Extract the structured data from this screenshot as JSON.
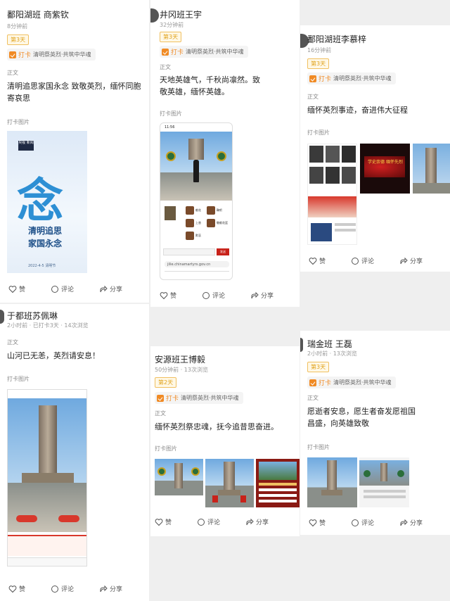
{
  "tabs": {
    "like": "赞",
    "comment": "评论",
    "share": "分享"
  },
  "checkin": {
    "label": "打卡",
    "topic": "清明祭英烈·共筑中华魂",
    "text_section": "正文",
    "image_section": "打卡图片"
  },
  "posts": [
    {
      "author": "鄱阳湖班 商紫钦",
      "meta": "8分钟前",
      "day": "第3天",
      "content": "清明追思家国永念 致敬英烈，缅怀同胞寄哀思",
      "poster": {
        "logo": "央视 新闻",
        "big_char": "念",
        "line1": "清明追思",
        "line2": "家国永念",
        "date": "2022-4-5 清明节"
      }
    },
    {
      "author": "井冈班王宇",
      "meta": "32分钟前",
      "day": "第3天",
      "content": "天地英雄气，千秋尚凛然。致敬英雄，缅怀英雄。",
      "phone": {
        "time": "11:56",
        "items": [
          "献花",
          "鞠躬",
          "上香",
          "敬献花篮",
          "默哀"
        ],
        "url": "jilie.chinamartyrs.gov.cn",
        "send": "发送"
      }
    },
    {
      "author": "鄱阳湖班李慕梓",
      "meta": "16分钟前",
      "day": "第3天",
      "content": "缅怀英烈事迹，奋进伟大征程",
      "banner": "学史崇德 缅怀先烈"
    },
    {
      "author": "于都班苏佩琳",
      "meta": "2小时前 · 已打卡3天 · 14次浏览",
      "content": "山河已无恙，英烈请安息！"
    },
    {
      "author": "安源班王博毅",
      "meta": "50分钟前 · 13次浏览",
      "day": "第2天",
      "content": "缅怀英烈祭忠魂，抚今追昔思奋进。"
    },
    {
      "author": "瑞金班 王磊",
      "meta": "2小时前 · 13次浏览",
      "day": "第3天",
      "content": "愿逝者安息，愿生者奋发愿祖国昌盛，向英雄致敬"
    }
  ],
  "colors": {
    "accent": "#f08a24",
    "day_badge": "#e0a21c",
    "sky": "#6fa9df",
    "flag_red": "#c8221a"
  }
}
